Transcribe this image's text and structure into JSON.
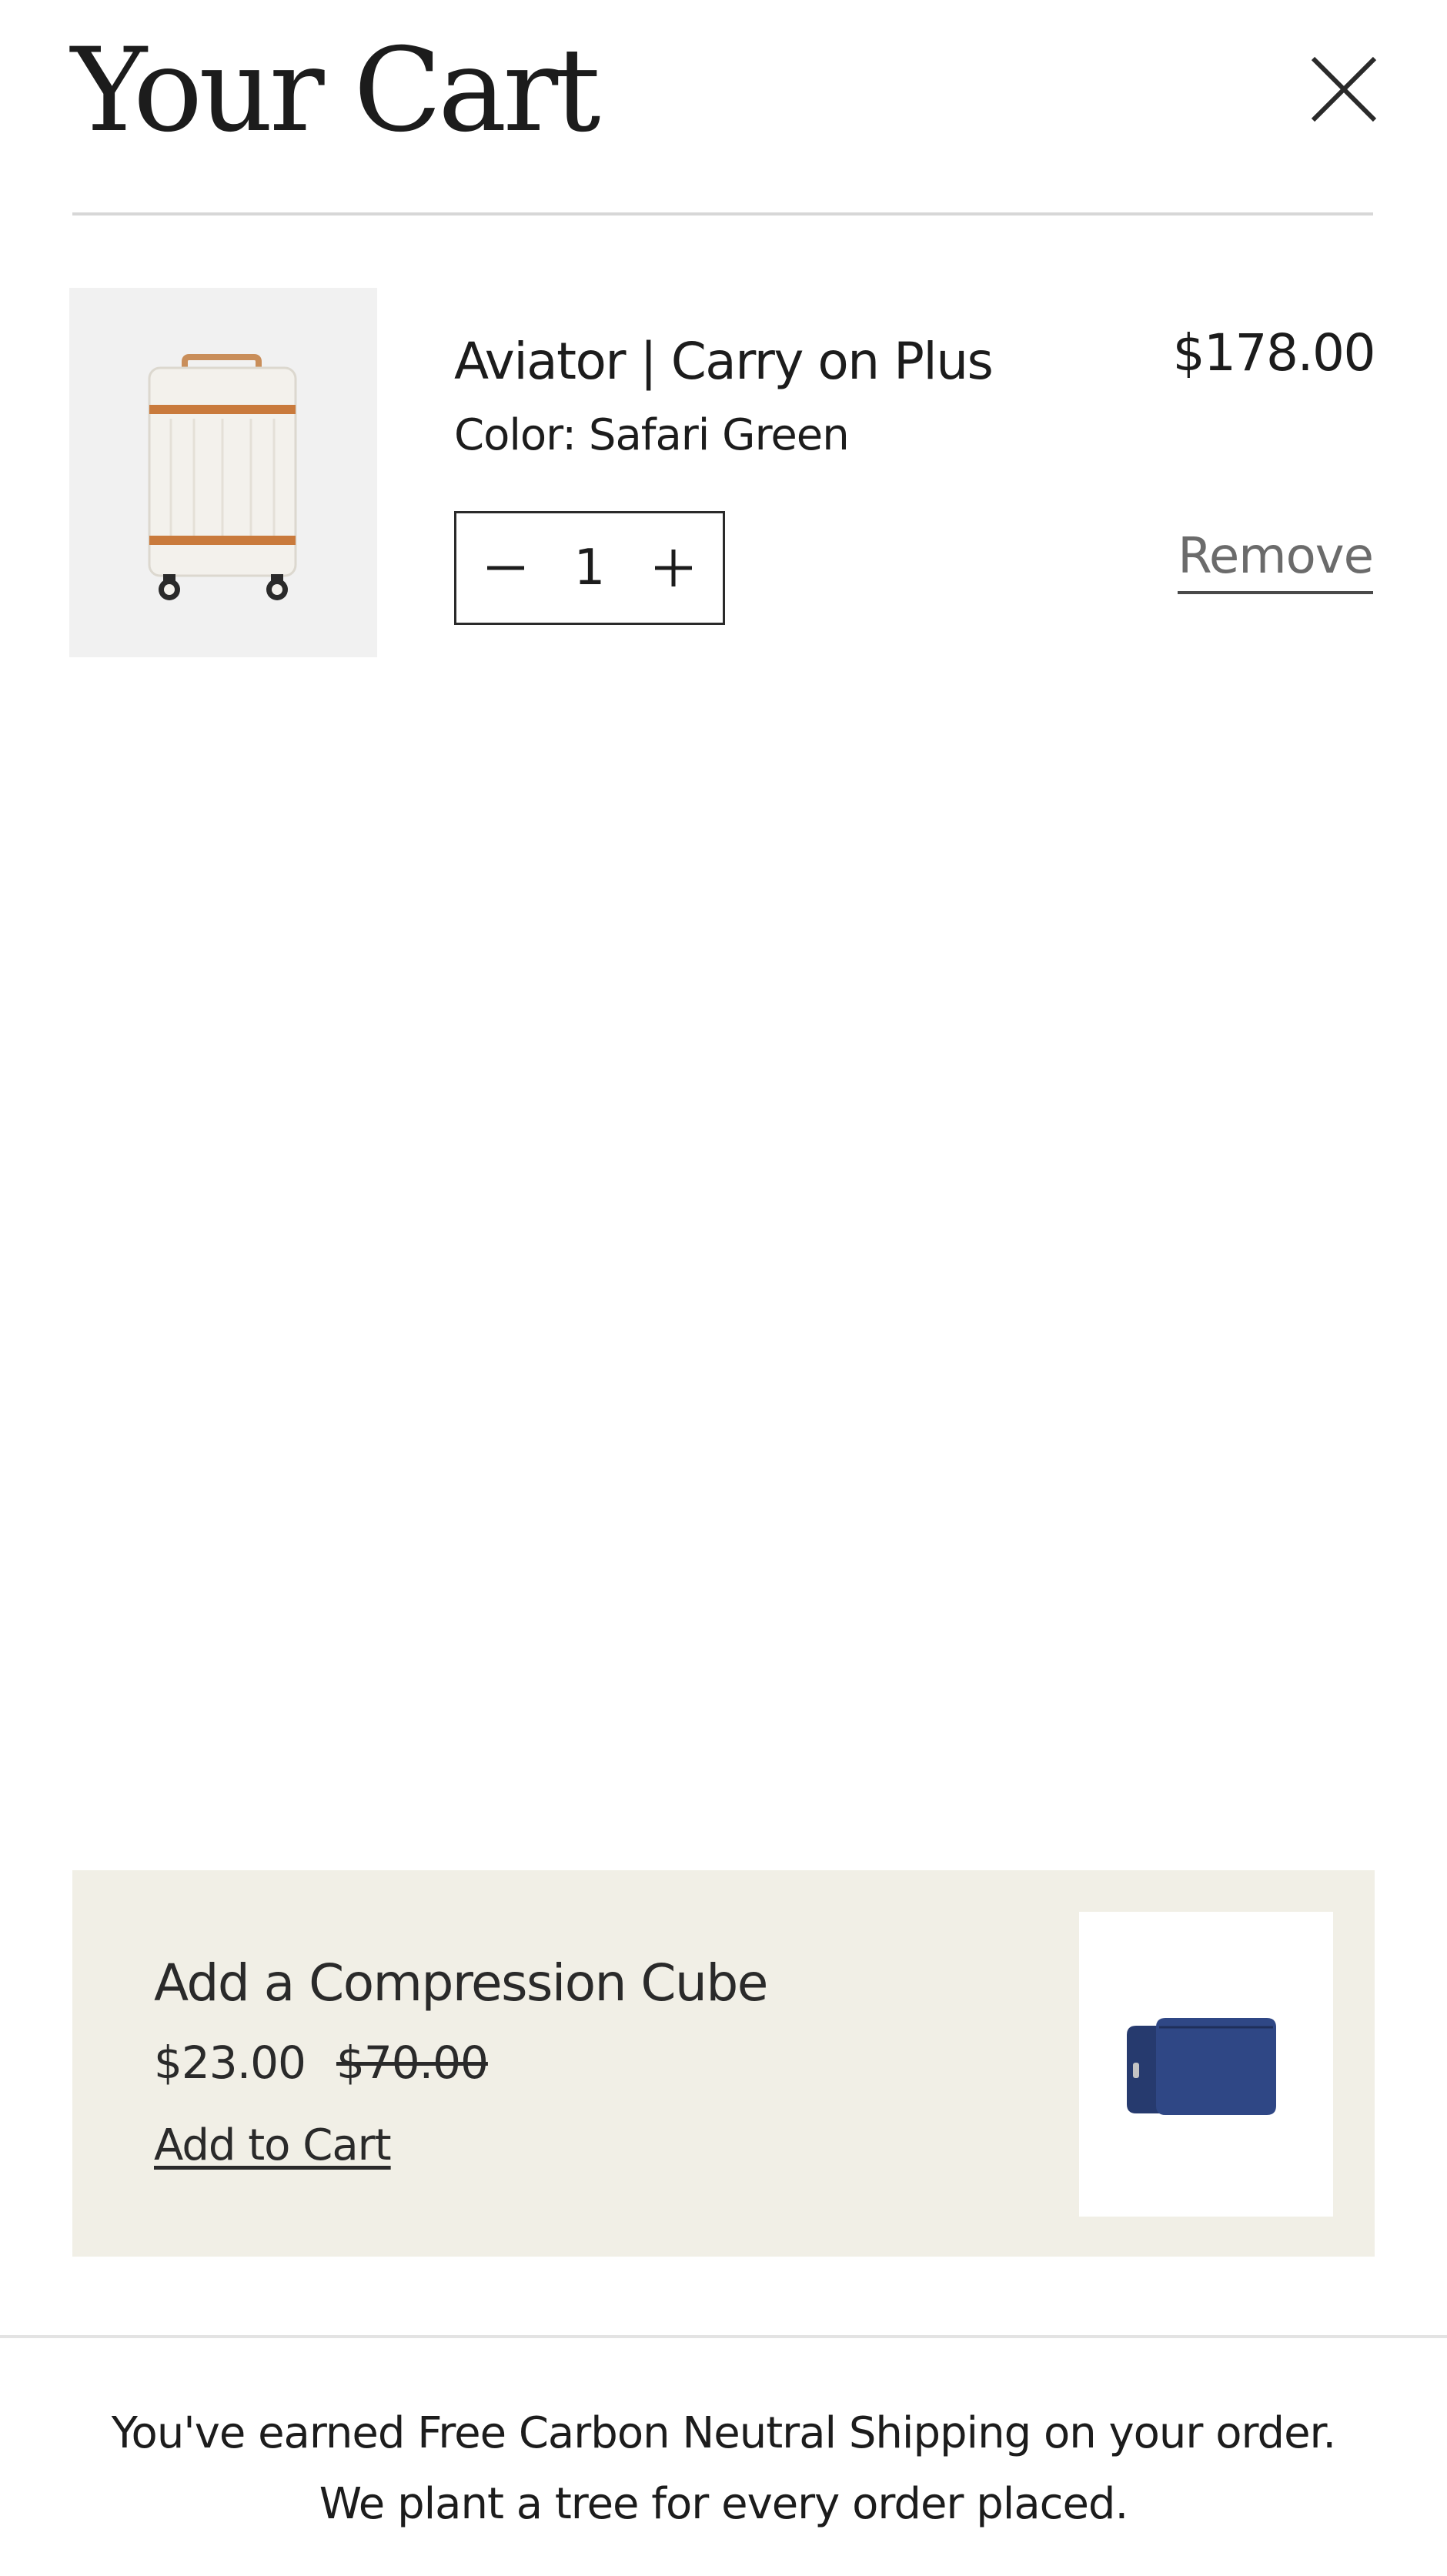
{
  "header": {
    "title": "Your Cart"
  },
  "cart": {
    "items": [
      {
        "name": "Aviator | Carry on Plus",
        "variant": "Color: Safari Green",
        "price": "$178.00",
        "quantity": "1",
        "remove_label": "Remove"
      }
    ]
  },
  "upsell": {
    "title": "Add a Compression Cube",
    "sale_price": "$23.00",
    "compare_price": "$70.00",
    "add_label": "Add to Cart"
  },
  "footer": {
    "line1": "You've earned Free Carbon Neutral Shipping on your order.",
    "line2": "We plant a tree for every order placed."
  },
  "icons": {
    "close": "close-icon",
    "minus": "minus-icon",
    "plus": "plus-icon"
  },
  "colors": {
    "text": "#1c1c1c",
    "muted_text": "#6b6b6b",
    "divider": "#d7d7d7",
    "upsell_background": "#f1efe6",
    "thumbnail_background": "#f1f1f1",
    "product_trim": "#c97a3c",
    "cube_navy": "#2f4785"
  }
}
